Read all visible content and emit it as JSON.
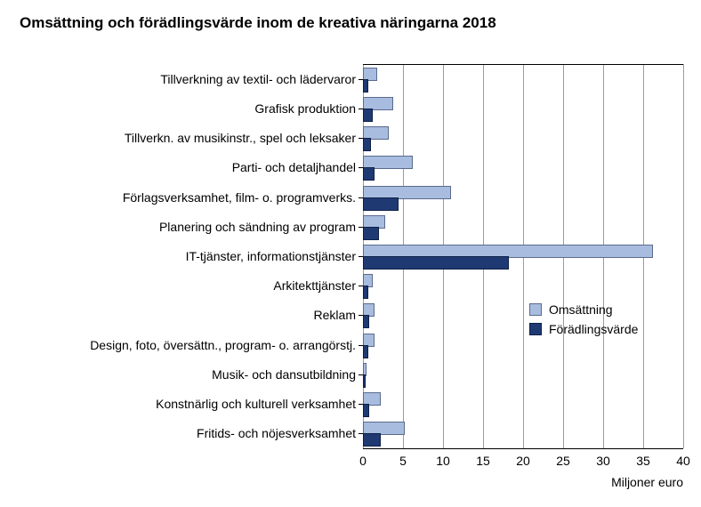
{
  "title": "Omsättning och förädlingsvärde inom de kreativa näringarna 2018",
  "xlabel": "Miljoner euro",
  "legend": {
    "oms": "Omsättning",
    "fv": "Förädlingsvärde"
  },
  "chart_data": {
    "type": "bar",
    "orientation": "horizontal",
    "categories": [
      "Tillverkning av textil- och lädervaror",
      "Grafisk produktion",
      "Tillverkn. av musikinstr., spel och leksaker",
      "Parti- och detaljhandel",
      "Förlagsverksamhet, film- o. programverks.",
      "Planering och sändning av program",
      "IT-tjänster, informationstjänster",
      "Arkitekttjänster",
      "Reklam",
      "Design, foto, översättn., program- o. arrangörstj.",
      "Musik- och dansutbildning",
      "Konstnärlig och kulturell verksamhet",
      "Fritids- och nöjesverksamhet"
    ],
    "series": [
      {
        "name": "Omsättning",
        "values": [
          1.5,
          3.5,
          3.0,
          6.0,
          10.8,
          2.5,
          36.0,
          1.0,
          1.2,
          1.2,
          0.2,
          2.0,
          5.0
        ]
      },
      {
        "name": "Förädlingsvärde",
        "values": [
          0.4,
          1.0,
          0.8,
          1.2,
          4.2,
          1.8,
          18.0,
          0.4,
          0.5,
          0.4,
          0.1,
          0.5,
          2.0
        ]
      }
    ],
    "xlim": [
      0,
      40
    ],
    "xticks": [
      0,
      5,
      10,
      15,
      20,
      25,
      30,
      35,
      40
    ],
    "title": "Omsättning och förädlingsvärde inom de kreativa näringarna 2018",
    "xlabel": "Miljoner euro",
    "ylabel": "",
    "grid": true,
    "legend_position": "right"
  }
}
